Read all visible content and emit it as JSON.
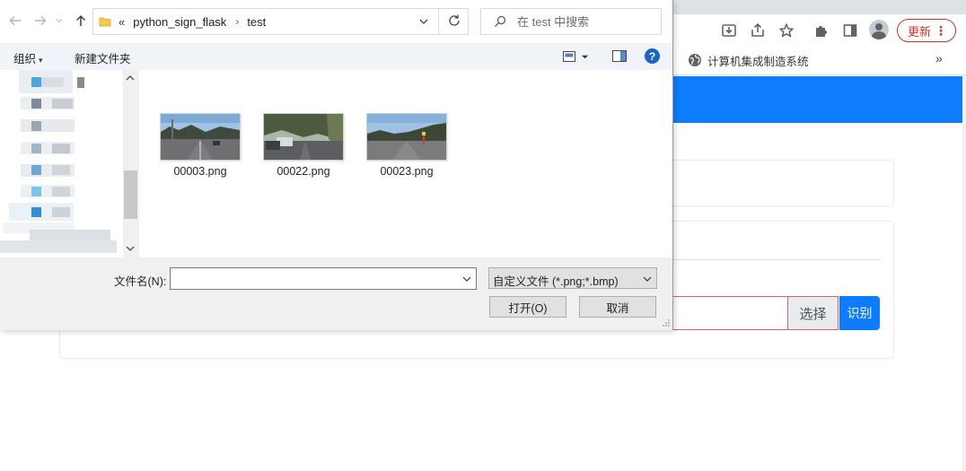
{
  "browser": {
    "update_label": "更新",
    "update_menu": "⋮",
    "bookmark_label": "计算机集成制造系统",
    "bookmarks_more": "»",
    "colors": {
      "accent_blue": "#0d7cff",
      "update_red": "#d93025"
    }
  },
  "webpage": {
    "choose_button": "选择",
    "recognize_button": "识别"
  },
  "dialog": {
    "breadcrumb_overflow": "«",
    "breadcrumb": [
      "python_sign_flask",
      "test"
    ],
    "breadcrumb_sep": "›",
    "search_placeholder": "在 test 中搜索",
    "toolbar": {
      "organize": "组织",
      "new_folder": "新建文件夹",
      "help": "?"
    },
    "files": [
      {
        "name": "00003.png"
      },
      {
        "name": "00022.png"
      },
      {
        "name": "00023.png"
      }
    ],
    "filename_label": "文件名(N):",
    "filename_value": "",
    "filetype_selected": "自定义文件 (*.png;*.bmp)",
    "open_button": "打开(O)",
    "cancel_button": "取消"
  }
}
